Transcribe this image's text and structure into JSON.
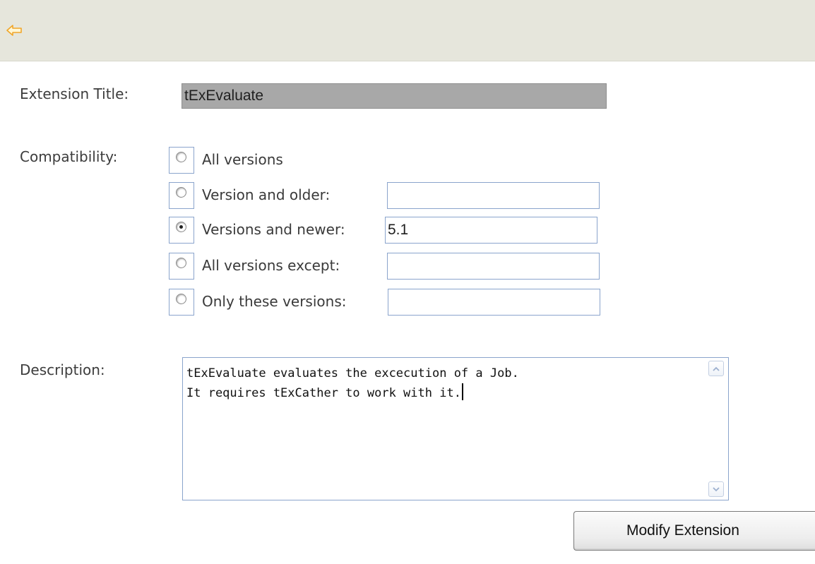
{
  "toolbar": {
    "back_icon": "back-arrow-icon"
  },
  "form": {
    "title_label": "Extension Title:",
    "title_value": "tExEvaluate",
    "compatibility_label": "Compatibility:",
    "options": [
      {
        "label": "All versions",
        "selected": false,
        "has_field": false,
        "value": ""
      },
      {
        "label": "Version and older:",
        "selected": false,
        "has_field": true,
        "value": ""
      },
      {
        "label": "Versions and newer:",
        "selected": true,
        "has_field": true,
        "value": "5.1"
      },
      {
        "label": "All versions except:",
        "selected": false,
        "has_field": true,
        "value": ""
      },
      {
        "label": "Only these versions:",
        "selected": false,
        "has_field": true,
        "value": ""
      }
    ],
    "description_label": "Description:",
    "description_lines": [
      "tExEvaluate evaluates the excecution of a Job.",
      "It requires tExCather to work with it."
    ]
  },
  "actions": {
    "modify_label": "Modify Extension"
  },
  "colors": {
    "toolbar_bg": "#e6e6dc",
    "back_arrow": "#f0a62a",
    "field_border": "#8aa4cc",
    "disabled_field_bg": "#a8a8a8"
  }
}
